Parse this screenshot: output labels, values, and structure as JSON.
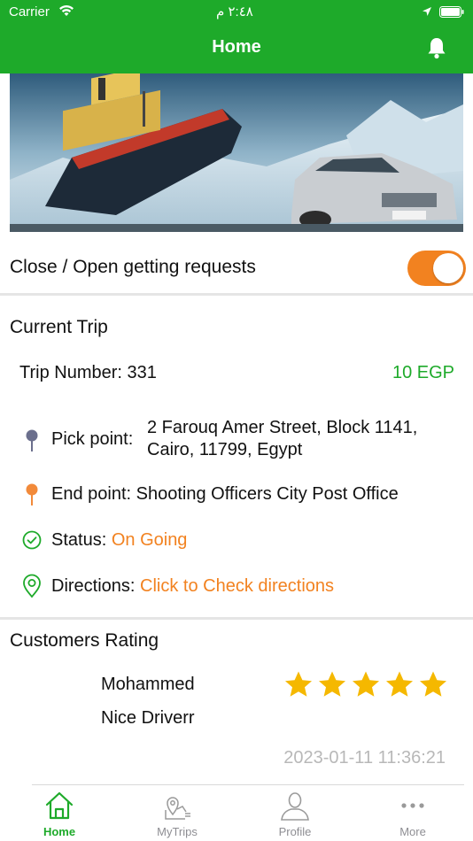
{
  "status_bar": {
    "carrier": "Carrier",
    "time": "٢:٤٨ م"
  },
  "header": {
    "title": "Home",
    "notification_icon": "bell-icon"
  },
  "toggle": {
    "label": "Close / Open getting requests",
    "on": true,
    "color": "#f28220"
  },
  "current_trip": {
    "title": "Current Trip",
    "trip_number": "Trip Number: 331",
    "price": "10 EGP",
    "pick_label": "Pick point:",
    "pick_value": "2 Farouq Amer Street,  Block 1141, Cairo, 11799, Egypt",
    "end_label": "End point:",
    "end_value": "Shooting Officers City Post Office",
    "status_label": "Status:",
    "status_value": "On Going",
    "directions_label": "Directions:",
    "directions_link": "Click to Check directions"
  },
  "customers_rating": {
    "title": "Customers Rating",
    "name": "Mohammed",
    "comment": "Nice Driverr",
    "stars": 5,
    "date": "2023-01-11 11:36:21"
  },
  "tabbar": {
    "tabs": [
      {
        "label": "Home",
        "icon": "home-icon",
        "active": true
      },
      {
        "label": "MyTrips",
        "icon": "map-trips-icon",
        "active": false
      },
      {
        "label": "Profile",
        "icon": "person-icon",
        "active": false
      },
      {
        "label": "More",
        "icon": "more-dots-icon",
        "active": false
      }
    ]
  },
  "colors": {
    "brand": "#1eaa2a",
    "accent": "#f28220",
    "muted": "#b8b8b8"
  }
}
